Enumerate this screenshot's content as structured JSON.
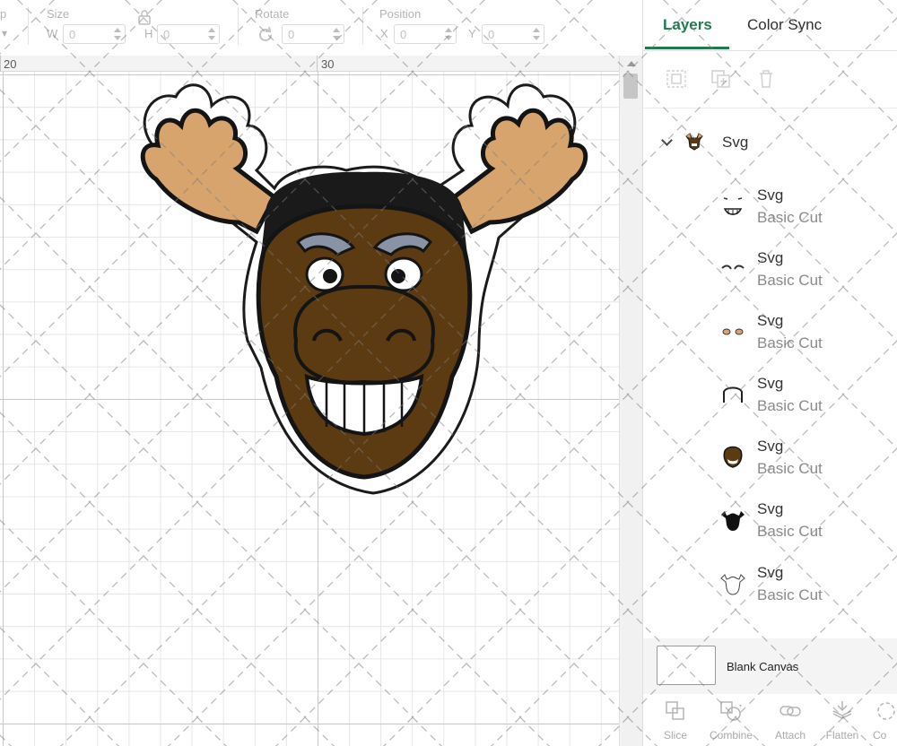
{
  "toolbar": {
    "partial_label": "p",
    "size_label": "Size",
    "width_axis": "W",
    "width_value": "0",
    "height_axis": "H",
    "height_value": "0",
    "rotate_label": "Rotate",
    "rotate_value": "0",
    "position_label": "Position",
    "x_axis": "X",
    "x_value": "0",
    "y_axis": "Y",
    "y_value": "0"
  },
  "ruler": {
    "marks": [
      "20",
      "30"
    ]
  },
  "panel": {
    "tabs": [
      {
        "label": "Layers",
        "active": true
      },
      {
        "label": "Color Sync",
        "active": false
      }
    ],
    "actions": [
      {
        "name": "group",
        "icon": "group-icon"
      },
      {
        "name": "duplicate",
        "icon": "duplicate-icon"
      },
      {
        "name": "delete",
        "icon": "trash-icon"
      }
    ],
    "group": {
      "name": "Svg",
      "expanded": true,
      "icon": "chevron-down-icon"
    },
    "layers": [
      {
        "name": "Svg",
        "operation": "Basic Cut",
        "thumb": "teeth"
      },
      {
        "name": "Svg",
        "operation": "Basic Cut",
        "thumb": "eyebrows"
      },
      {
        "name": "Svg",
        "operation": "Basic Cut",
        "thumb": "eyes"
      },
      {
        "name": "Svg",
        "operation": "Basic Cut",
        "thumb": "hair"
      },
      {
        "name": "Svg",
        "operation": "Basic Cut",
        "thumb": "head"
      },
      {
        "name": "Svg",
        "operation": "Basic Cut",
        "thumb": "silhouette"
      },
      {
        "name": "Svg",
        "operation": "Basic Cut",
        "thumb": "outline"
      }
    ],
    "blank_canvas_label": "Blank Canvas",
    "bottom_actions": [
      {
        "label": "Slice",
        "icon": "slice-icon"
      },
      {
        "label": "Combine",
        "icon": "combine-icon"
      },
      {
        "label": "Attach",
        "icon": "attach-icon"
      },
      {
        "label": "Flatten",
        "icon": "flatten-icon"
      },
      {
        "label": "Co",
        "icon": "contour-icon"
      }
    ]
  },
  "colors": {
    "accent": "#1f7a4c",
    "moose_brown": "#5c3a12",
    "antler_tan": "#d6a46c",
    "brow_gray": "#8a93a6"
  }
}
